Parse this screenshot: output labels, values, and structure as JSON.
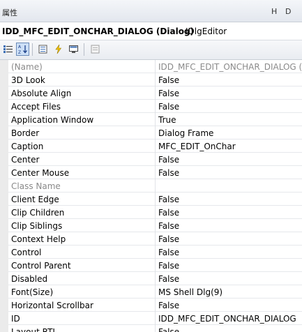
{
  "window": {
    "title": "属性",
    "btn_h": "H",
    "btn_d": "D"
  },
  "object": {
    "name": "IDD_MFC_EDIT_ONCHAR_DIALOG (Dialog)",
    "type": "IDlgEditor"
  },
  "toolbar": {
    "icons": [
      "categorized-icon",
      "alphabetical-icon",
      "properties-icon",
      "events-icon",
      "messages-icon",
      "property-pages-icon"
    ],
    "active": [
      "alphabetical-icon"
    ]
  },
  "properties": [
    {
      "name": "(Name)",
      "value": "IDD_MFC_EDIT_ONCHAR_DIALOG (D",
      "muted": true
    },
    {
      "name": "3D Look",
      "value": "False"
    },
    {
      "name": "Absolute Align",
      "value": "False"
    },
    {
      "name": "Accept Files",
      "value": "False"
    },
    {
      "name": "Application Window",
      "value": "True"
    },
    {
      "name": "Border",
      "value": "Dialog Frame"
    },
    {
      "name": "Caption",
      "value": "MFC_EDIT_OnChar"
    },
    {
      "name": "Center",
      "value": "False"
    },
    {
      "name": "Center Mouse",
      "value": "False"
    },
    {
      "name": "Class Name",
      "value": "",
      "muted": true
    },
    {
      "name": "Client Edge",
      "value": "False"
    },
    {
      "name": "Clip Children",
      "value": "False"
    },
    {
      "name": "Clip Siblings",
      "value": "False"
    },
    {
      "name": "Context Help",
      "value": "False"
    },
    {
      "name": "Control",
      "value": "False"
    },
    {
      "name": "Control Parent",
      "value": "False"
    },
    {
      "name": "Disabled",
      "value": "False"
    },
    {
      "name": "Font(Size)",
      "value": "MS Shell Dlg(9)"
    },
    {
      "name": "Horizontal Scrollbar",
      "value": "False"
    },
    {
      "name": "ID",
      "value": "IDD_MFC_EDIT_ONCHAR_DIALOG"
    },
    {
      "name": "Layout RTL",
      "value": "False"
    }
  ]
}
